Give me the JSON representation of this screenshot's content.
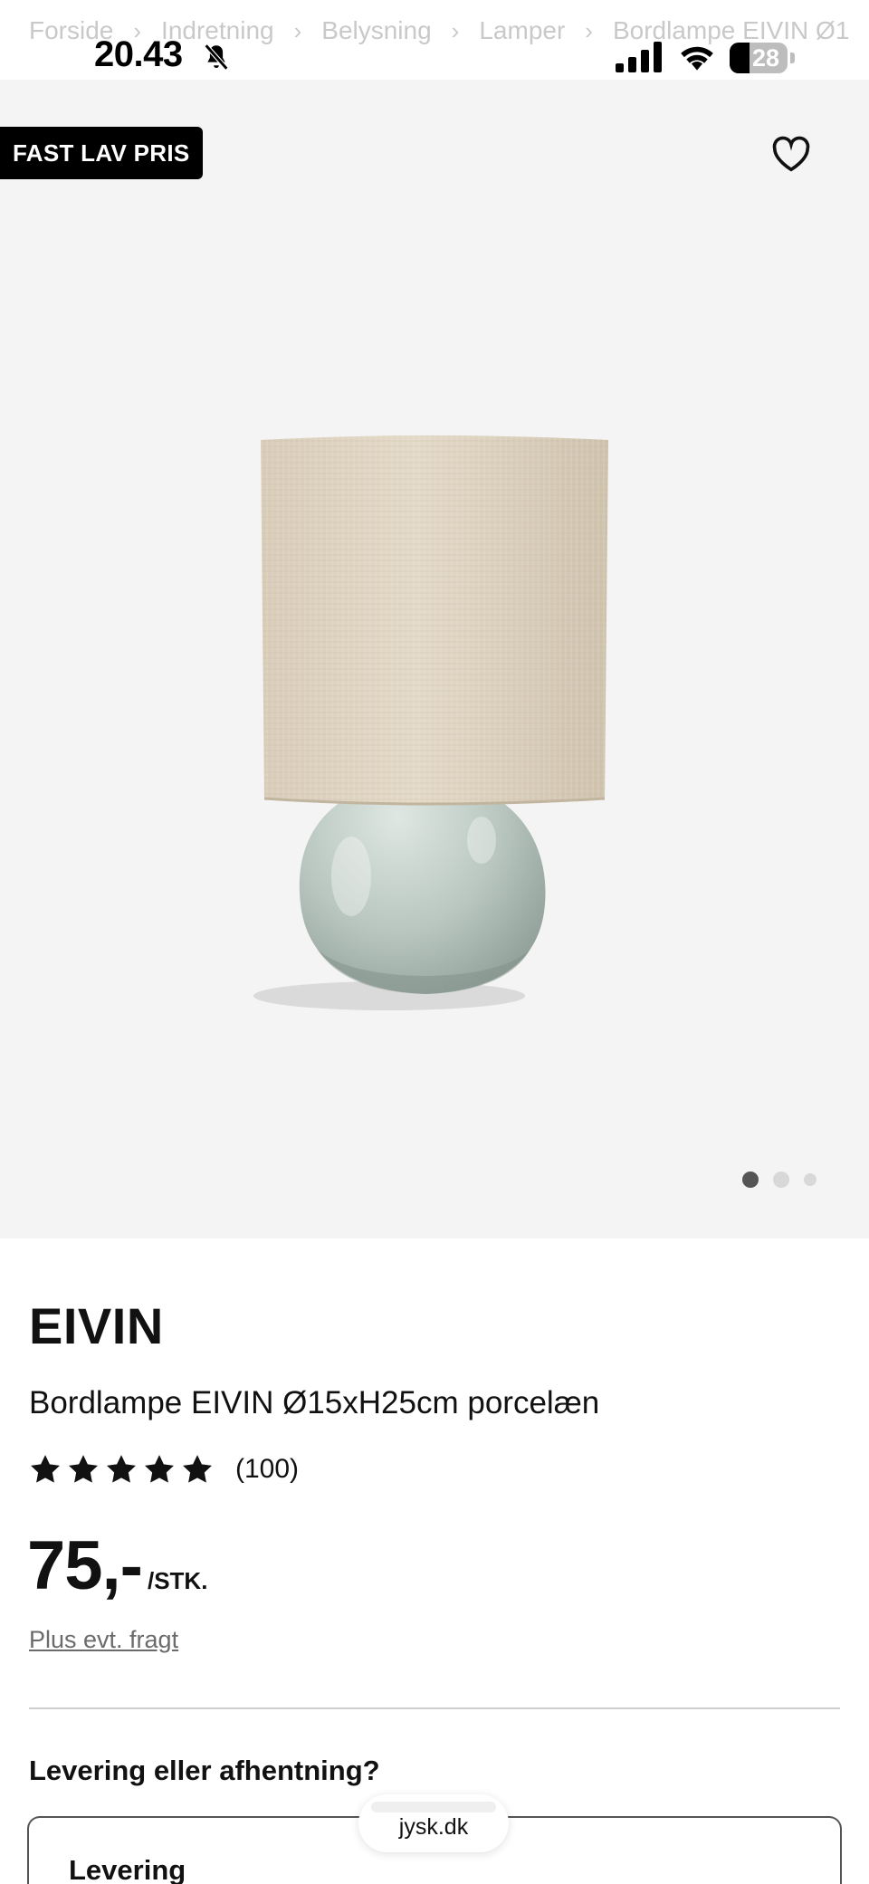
{
  "breadcrumb": [
    "Forside",
    "Indretning",
    "Belysning",
    "Lamper",
    "Bordlampe EIVIN Ø1"
  ],
  "status": {
    "time": "20.43",
    "battery": "28"
  },
  "badge": "FAST LAV PRIS",
  "gallery": {
    "total": 3,
    "active": 1
  },
  "product": {
    "brand": "EIVIN",
    "name": "Bordlampe EIVIN Ø15xH25cm porcelæn",
    "rating": 5,
    "rating_count": "(100)",
    "price": "75,-",
    "price_unit": "/STK.",
    "shipping": "Plus evt. fragt"
  },
  "delivery": {
    "heading": "Levering eller afhentning?",
    "option": "Levering"
  },
  "browser": {
    "url": "jysk.dk"
  }
}
